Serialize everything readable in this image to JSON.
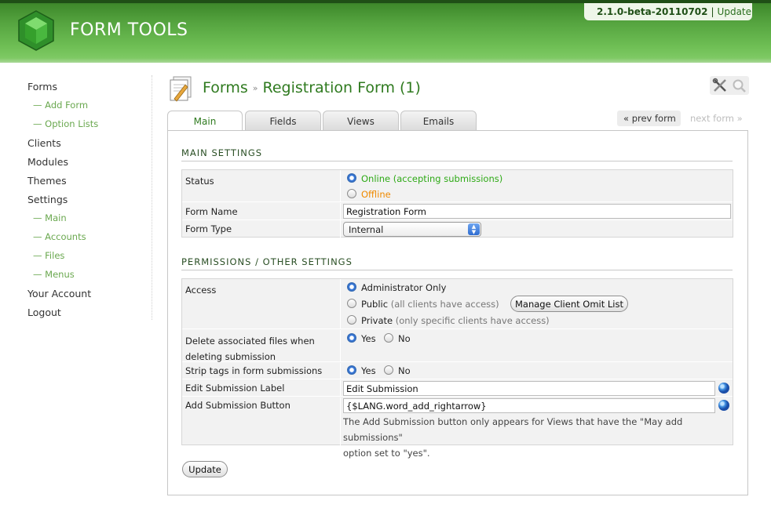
{
  "header": {
    "brand": "FORM TOOLS",
    "version": "2.1.0-beta-20110702",
    "separator": "|",
    "update_label": "Update"
  },
  "sidebar": {
    "forms": "Forms",
    "add_form": "— Add Form",
    "option_lists": "— Option Lists",
    "clients": "Clients",
    "modules": "Modules",
    "themes": "Themes",
    "settings": "Settings",
    "settings_main": "— Main",
    "settings_accounts": "— Accounts",
    "settings_files": "— Files",
    "settings_menus": "— Menus",
    "your_account": "Your Account",
    "logout": "Logout"
  },
  "page": {
    "breadcrumb_root": "Forms",
    "breadcrumb_sep": "»",
    "title": "Registration Form (1)"
  },
  "tabs": {
    "main": "Main",
    "fields": "Fields",
    "views": "Views",
    "emails": "Emails"
  },
  "pager": {
    "prev": "« prev form",
    "next": "next form »"
  },
  "main_settings": {
    "heading": "MAIN SETTINGS",
    "status_label": "Status",
    "status_online": "Online (accepting submissions)",
    "status_offline": "Offline",
    "status_selected": "online",
    "form_name_label": "Form Name",
    "form_name_value": "Registration Form",
    "form_type_label": "Form Type",
    "form_type_value": "Internal"
  },
  "permissions": {
    "heading": "PERMISSIONS / OTHER SETTINGS",
    "access_label": "Access",
    "access_admin": "Administrator Only",
    "access_public": "Public",
    "access_public_note": "(all clients have access)",
    "access_private": "Private",
    "access_private_note": "(only specific clients have access)",
    "manage_omit_button": "Manage Client Omit List",
    "access_selected": "admin",
    "delete_files_label_1": "Delete associated files when",
    "delete_files_label_2": "deleting submission",
    "yes": "Yes",
    "no": "No",
    "delete_files_selected": "yes",
    "strip_tags_label": "Strip tags in form submissions",
    "strip_tags_selected": "yes",
    "edit_label_label": "Edit Submission Label",
    "edit_label_value": "Edit Submission",
    "add_button_label": "Add Submission Button",
    "add_button_value": "{$LANG.word_add_rightarrow}",
    "add_button_help_1": "The Add Submission button only appears for Views that have the \"May add submissions\"",
    "add_button_help_2": "option set to \"yes\"."
  },
  "actions": {
    "update_button": "Update"
  },
  "icons": [
    "form-tools-logo",
    "forms-page-icon",
    "tools-icon",
    "search-icon",
    "globe-icon",
    "select-arrow-icon"
  ]
}
